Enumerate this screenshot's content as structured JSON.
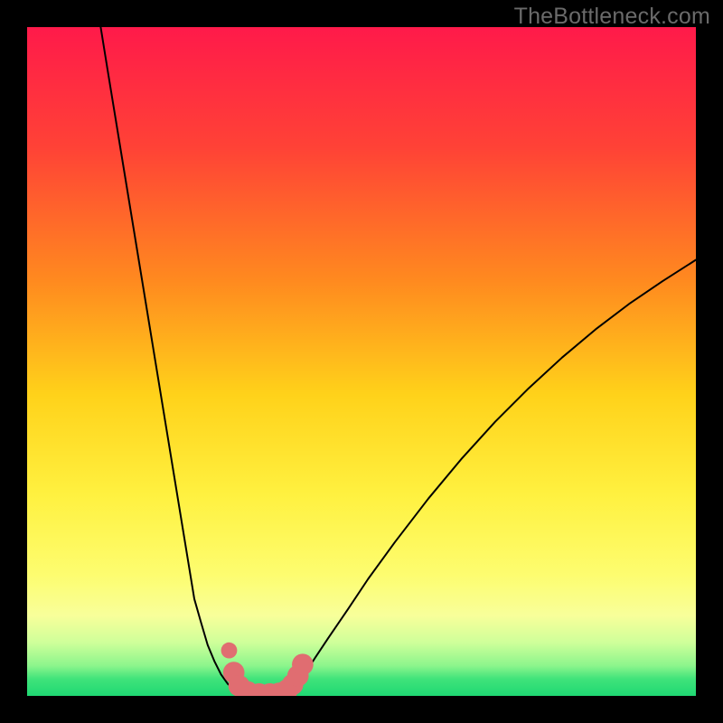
{
  "watermark": {
    "text": "TheBottleneck.com"
  },
  "chart_data": {
    "type": "line",
    "title": "",
    "xlabel": "",
    "ylabel": "",
    "xlim": [
      0,
      100
    ],
    "ylim": [
      0,
      100
    ],
    "grid": false,
    "legend": false,
    "background_gradient_stops": [
      {
        "offset": 0.0,
        "color": "#ff1a4a"
      },
      {
        "offset": 0.18,
        "color": "#ff4236"
      },
      {
        "offset": 0.38,
        "color": "#ff8a1f"
      },
      {
        "offset": 0.55,
        "color": "#ffd21a"
      },
      {
        "offset": 0.7,
        "color": "#fff140"
      },
      {
        "offset": 0.82,
        "color": "#fdfd70"
      },
      {
        "offset": 0.88,
        "color": "#f8ff9a"
      },
      {
        "offset": 0.92,
        "color": "#cfff9a"
      },
      {
        "offset": 0.955,
        "color": "#8cf58c"
      },
      {
        "offset": 0.975,
        "color": "#3fe37a"
      },
      {
        "offset": 1.0,
        "color": "#1fd873"
      }
    ],
    "series": [
      {
        "name": "bottleneck-curve-left",
        "stroke": "#000000",
        "points": [
          {
            "x": 11.0,
            "y": 100.0
          },
          {
            "x": 12.0,
            "y": 93.8
          },
          {
            "x": 13.0,
            "y": 87.7
          },
          {
            "x": 14.0,
            "y": 81.6
          },
          {
            "x": 15.0,
            "y": 75.5
          },
          {
            "x": 16.0,
            "y": 69.4
          },
          {
            "x": 17.0,
            "y": 63.3
          },
          {
            "x": 18.0,
            "y": 57.2
          },
          {
            "x": 19.0,
            "y": 51.1
          },
          {
            "x": 20.0,
            "y": 45.0
          },
          {
            "x": 21.0,
            "y": 38.9
          },
          {
            "x": 22.0,
            "y": 32.8
          },
          {
            "x": 23.0,
            "y": 26.7
          },
          {
            "x": 24.0,
            "y": 20.6
          },
          {
            "x": 25.0,
            "y": 14.5
          },
          {
            "x": 26.0,
            "y": 11.0
          },
          {
            "x": 27.0,
            "y": 7.6
          },
          {
            "x": 28.0,
            "y": 5.2
          },
          {
            "x": 29.0,
            "y": 3.2
          },
          {
            "x": 30.0,
            "y": 1.8
          },
          {
            "x": 31.0,
            "y": 1.0
          },
          {
            "x": 32.0,
            "y": 0.6
          },
          {
            "x": 33.0,
            "y": 0.4
          }
        ]
      },
      {
        "name": "bottleneck-curve-bottom",
        "stroke": "#000000",
        "points": [
          {
            "x": 33.0,
            "y": 0.4
          },
          {
            "x": 34.0,
            "y": 0.3
          },
          {
            "x": 35.0,
            "y": 0.3
          },
          {
            "x": 36.0,
            "y": 0.3
          },
          {
            "x": 37.0,
            "y": 0.4
          },
          {
            "x": 38.0,
            "y": 0.4
          }
        ]
      },
      {
        "name": "bottleneck-curve-right",
        "stroke": "#000000",
        "points": [
          {
            "x": 38.0,
            "y": 0.4
          },
          {
            "x": 39.0,
            "y": 0.8
          },
          {
            "x": 40.0,
            "y": 1.6
          },
          {
            "x": 41.0,
            "y": 2.6
          },
          {
            "x": 42.0,
            "y": 4.0
          },
          {
            "x": 43.0,
            "y": 5.6
          },
          {
            "x": 45.0,
            "y": 8.6
          },
          {
            "x": 48.0,
            "y": 13.0
          },
          {
            "x": 51.0,
            "y": 17.5
          },
          {
            "x": 55.0,
            "y": 23.0
          },
          {
            "x": 60.0,
            "y": 29.5
          },
          {
            "x": 65.0,
            "y": 35.5
          },
          {
            "x": 70.0,
            "y": 41.0
          },
          {
            "x": 75.0,
            "y": 46.0
          },
          {
            "x": 80.0,
            "y": 50.6
          },
          {
            "x": 85.0,
            "y": 54.8
          },
          {
            "x": 90.0,
            "y": 58.6
          },
          {
            "x": 95.0,
            "y": 62.0
          },
          {
            "x": 100.0,
            "y": 65.2
          }
        ]
      }
    ],
    "markers": [
      {
        "x": 30.2,
        "y": 6.8,
        "r": 1.2,
        "color": "#e06d71"
      },
      {
        "x": 30.9,
        "y": 3.5,
        "r": 1.6,
        "color": "#e06d71"
      },
      {
        "x": 31.7,
        "y": 1.5,
        "r": 1.6,
        "color": "#e06d71"
      },
      {
        "x": 33.0,
        "y": 0.6,
        "r": 1.6,
        "color": "#e06d71"
      },
      {
        "x": 34.7,
        "y": 0.3,
        "r": 1.6,
        "color": "#e06d71"
      },
      {
        "x": 36.3,
        "y": 0.3,
        "r": 1.6,
        "color": "#e06d71"
      },
      {
        "x": 37.7,
        "y": 0.4,
        "r": 1.6,
        "color": "#e06d71"
      },
      {
        "x": 38.9,
        "y": 0.9,
        "r": 1.6,
        "color": "#e06d71"
      },
      {
        "x": 39.7,
        "y": 1.7,
        "r": 1.6,
        "color": "#e06d71"
      },
      {
        "x": 40.5,
        "y": 3.0,
        "r": 1.6,
        "color": "#e06d71"
      },
      {
        "x": 41.2,
        "y": 4.7,
        "r": 1.6,
        "color": "#e06d71"
      }
    ]
  }
}
